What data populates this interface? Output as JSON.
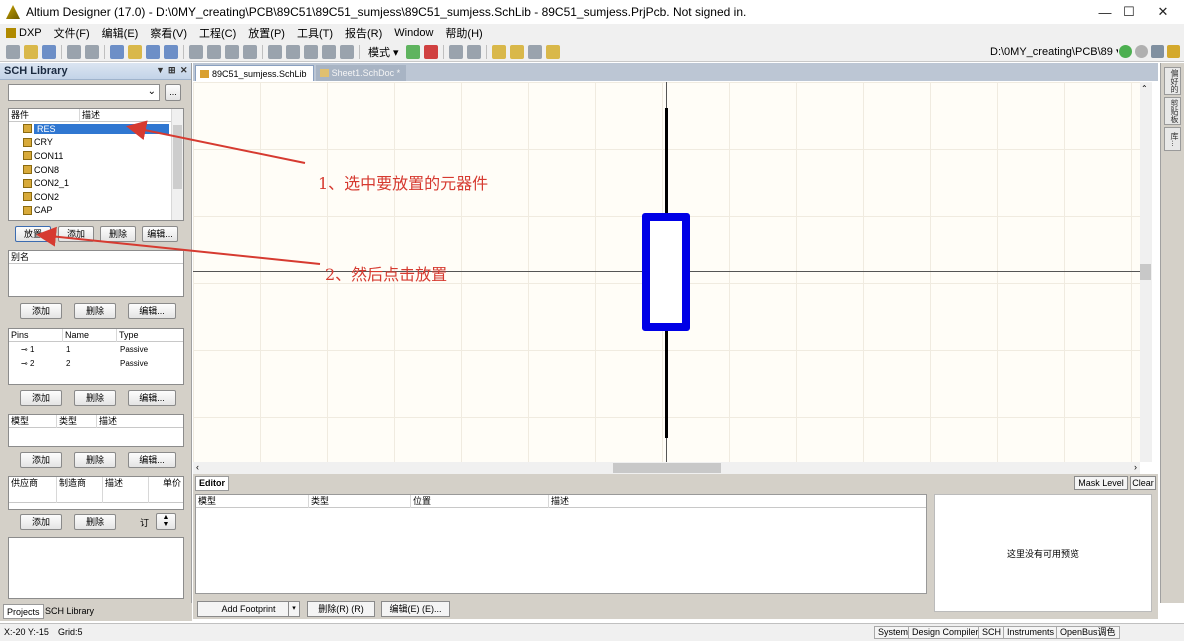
{
  "titlebar": {
    "title": "Altium Designer (17.0) - D:\\0MY_creating\\PCB\\89C51\\89C51_sumjess\\89C51_sumjess.SchLib - 89C51_sumjess.PrjPcb. Not signed in.",
    "minimize": "—",
    "maximize": "☐",
    "close": "✕"
  },
  "menubar": {
    "items": [
      "DXP",
      "文件(F)",
      "编辑(E)",
      "察看(V)",
      "工程(C)",
      "放置(P)",
      "工具(T)",
      "报告(R)",
      "Window",
      "帮助(H)"
    ]
  },
  "toolbar": {
    "mode_label": "模式 ▾",
    "path": "D:\\0MY_creating\\PCB\\89 ▾"
  },
  "sch_panel": {
    "title": "SCH Library",
    "header_controls": [
      "▼",
      "⊞",
      "✕"
    ],
    "filter_value": "",
    "filter_button": "...",
    "columns": [
      "器件",
      "描述"
    ],
    "components": [
      {
        "name": "RES",
        "selected": true
      },
      {
        "name": "CRY",
        "selected": false
      },
      {
        "name": "CON11",
        "selected": false
      },
      {
        "name": "CON8",
        "selected": false
      },
      {
        "name": "CON2_1",
        "selected": false
      },
      {
        "name": "CON2",
        "selected": false
      },
      {
        "name": "CAP",
        "selected": false
      }
    ],
    "comp_buttons": [
      "放置",
      "添加",
      "删除",
      "编辑..."
    ],
    "alias_header": "别名",
    "alias_buttons": [
      "添加",
      "删除",
      "编辑..."
    ],
    "pins_columns": [
      "Pins",
      "Name",
      "Type"
    ],
    "pins": [
      {
        "pin": "1",
        "name": "1",
        "type": "Passive"
      },
      {
        "pin": "2",
        "name": "2",
        "type": "Passive"
      }
    ],
    "pins_buttons": [
      "添加",
      "删除",
      "编辑..."
    ],
    "model_columns": [
      "模型",
      "类型",
      "描述"
    ],
    "model_buttons": [
      "添加",
      "删除",
      "编辑..."
    ],
    "supplier_columns": [
      "供应商",
      "制造商",
      "描述",
      "单价"
    ],
    "supplier_buttons": [
      "添加",
      "删除",
      "订"
    ],
    "bottom_tabs": [
      "Projects",
      "SCH Library"
    ]
  },
  "doc_tabs": [
    {
      "label": "89C51_sumjess.SchLib",
      "active": true
    },
    {
      "label": "Sheet1.SchDoc *",
      "active": false
    }
  ],
  "annotations": {
    "step1": "1、选中要放置的元器件",
    "step2": "2、然后点击放置"
  },
  "right_tabs": [
    "偏好的",
    "剪贴板",
    "库..."
  ],
  "editor": {
    "tab": "Editor",
    "mask_level": "Mask Level",
    "clear": "Clear",
    "columns": [
      "模型",
      "类型",
      "位置",
      "描述"
    ],
    "preview_text": "这里没有可用预览",
    "buttons": [
      "Add Footprint",
      "删除(R) (R)",
      "编辑(E) (E)..."
    ]
  },
  "statusbar": {
    "coords": "X:-20 Y:-15",
    "grid": "Grid:5",
    "panels": [
      "System",
      "Design Compiler",
      "SCH",
      "Instruments",
      "OpenBus调色"
    ]
  },
  "colors": {
    "resistor_body": "#0000e6",
    "annotation": "#d63a30",
    "selection": "#3077d1"
  }
}
